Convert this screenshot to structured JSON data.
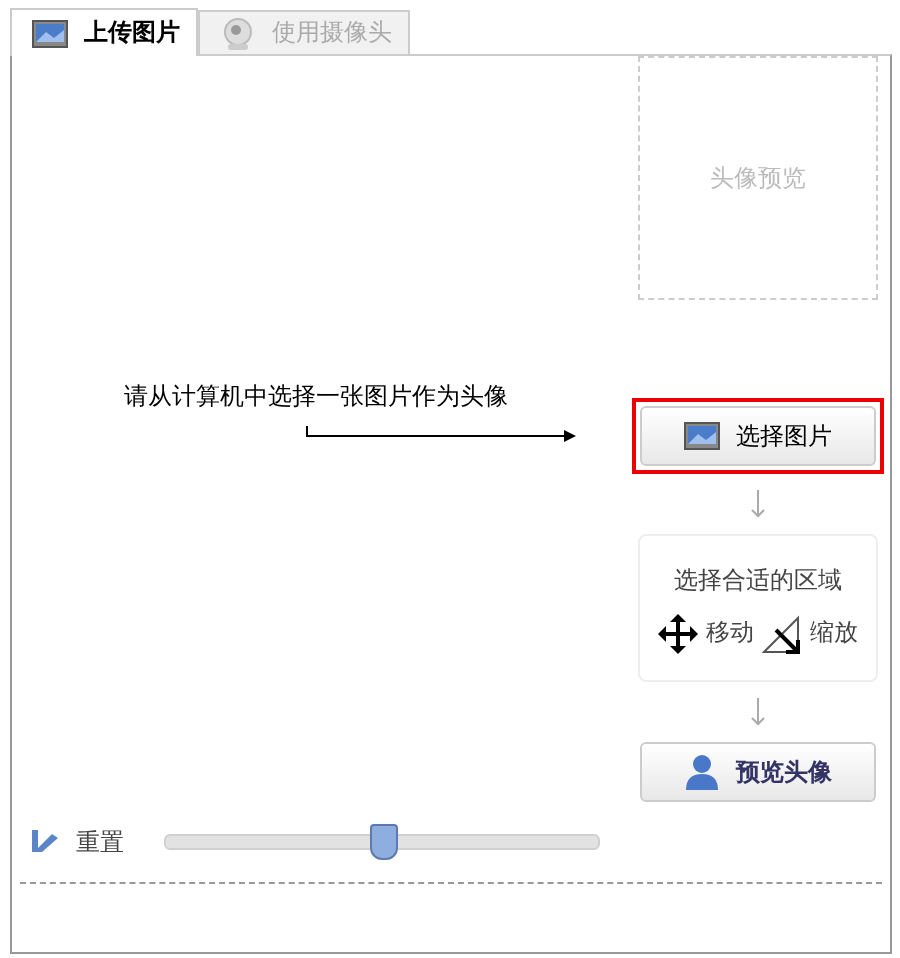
{
  "tabs": [
    {
      "label": "上传图片",
      "selected": true,
      "kind": "picture"
    },
    {
      "label": "使用摄像头",
      "selected": false,
      "kind": "camera"
    }
  ],
  "preview_placeholder": "头像预览",
  "instruction": "请从计算机中选择一张图片作为头像",
  "choose_button": {
    "label": "选择图片",
    "highlighted": true
  },
  "region_panel": {
    "title": "选择合适的区域",
    "move": "移动",
    "scale": "缩放"
  },
  "preview_button": "预览头像",
  "reset": "重置",
  "zoom_slider": {
    "level": 0.5
  }
}
